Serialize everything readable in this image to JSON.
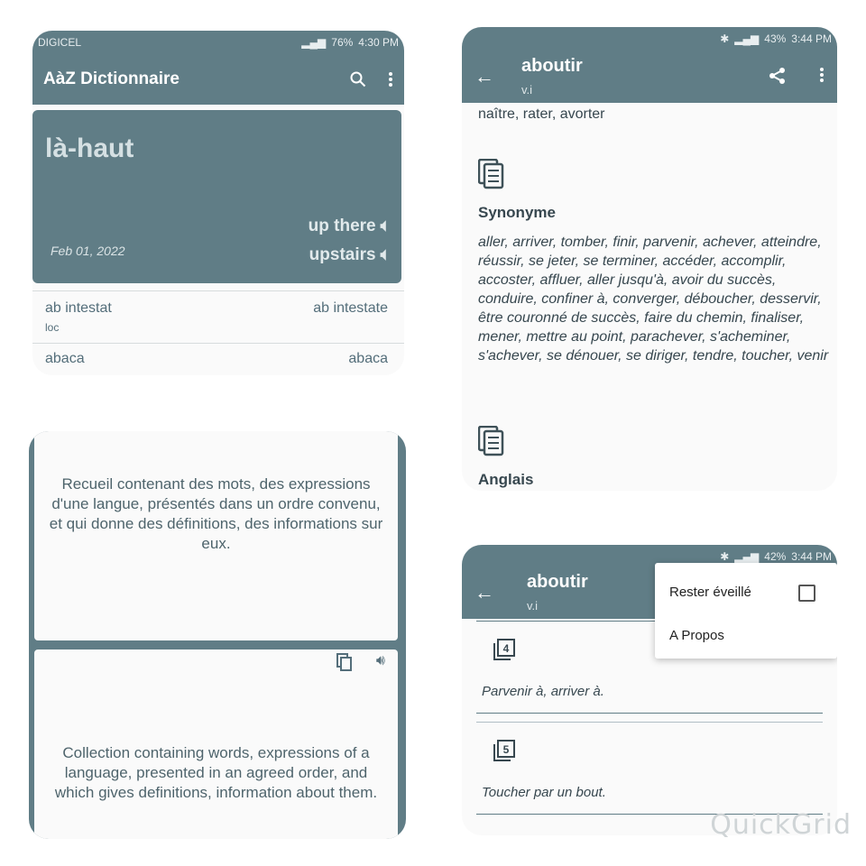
{
  "panel1": {
    "status": {
      "carrier": "DIGICEL",
      "battery": "76%",
      "time": "4:30 PM"
    },
    "appbar": {
      "title": "AàZ Dictionnaire",
      "search_icon": "search-icon",
      "more_icon": "more-vert-icon"
    },
    "word_card": {
      "word": "là-haut",
      "date": "Feb 01, 2022",
      "translations": [
        "up there",
        "upstairs"
      ]
    },
    "list": [
      {
        "fr": "ab intestat",
        "pos": "loc",
        "en": "ab intestate"
      },
      {
        "fr": "abaca",
        "en": "abaca"
      }
    ]
  },
  "panel2": {
    "status": {
      "battery": "43%",
      "time": "3:44 PM"
    },
    "appbar": {
      "title": "aboutir",
      "subtitle": "v.i"
    },
    "top_text": "naître, rater, avorter",
    "synonyme": {
      "title": "Synonyme",
      "text": "aller, arriver, tomber, finir, parvenir, achever, atteindre, réussir, se jeter, se terminer, accéder, accomplir, accoster, affluer, aller jusqu'à, avoir du succès, conduire, confiner à, converger, déboucher, desservir, être couronné de succès, faire du chemin, finaliser, mener, mettre au point, parachever, s'acheminer, s'achever, se dénouer, se diriger, tendre, toucher, venir"
    },
    "anglais": {
      "title": "Anglais"
    }
  },
  "panel3": {
    "french_definition": "Recueil contenant des mots, des expressions d'une langue, présentés dans un ordre convenu, et qui donne des définitions, des informations sur eux.",
    "english_definition": "Collection containing words, expressions of a language, presented in an agreed order, and which gives definitions, information about them."
  },
  "panel4": {
    "status": {
      "battery": "42%",
      "time": "3:44 PM"
    },
    "appbar": {
      "title": "aboutir",
      "subtitle": "v.i"
    },
    "menu": {
      "stay_awake": "Rester éveillé",
      "about": "A Propos"
    },
    "definitions": [
      {
        "num": "4",
        "text": "Parvenir à, arriver à."
      },
      {
        "num": "5",
        "text": "Toucher par un bout."
      }
    ]
  },
  "watermark": "QuickGrid",
  "colors": {
    "primary": "#607d86",
    "background": "#fafafa"
  }
}
